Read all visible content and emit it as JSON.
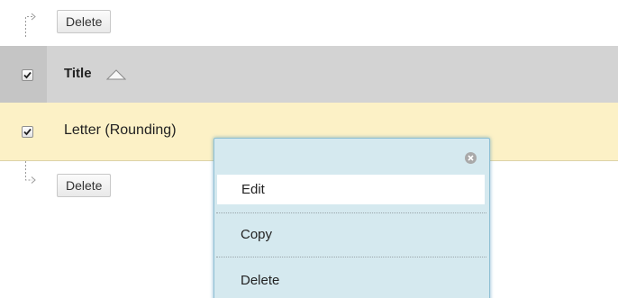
{
  "top_action": {
    "delete_label": "Delete"
  },
  "bottom_action": {
    "delete_label": "Delete"
  },
  "table": {
    "header": {
      "title_label": "Title",
      "select_all_checked": true
    },
    "rows": [
      {
        "title": "Letter (Rounding)",
        "checked": true
      }
    ]
  },
  "context_menu": {
    "items": [
      {
        "label": "Edit",
        "highlighted": true
      },
      {
        "label": "Copy"
      },
      {
        "label": "Delete"
      }
    ]
  },
  "icons": {
    "arrow": "arrow-right-icon",
    "sort": "sort-ascending-icon",
    "close": "close-circle-icon",
    "check": "check-icon"
  },
  "colors": {
    "header_bg": "#d3d3d3",
    "row_highlight_bg": "#fcf1c6",
    "menu_bg": "#d5e9ef",
    "menu_border": "#8fc0d4"
  }
}
